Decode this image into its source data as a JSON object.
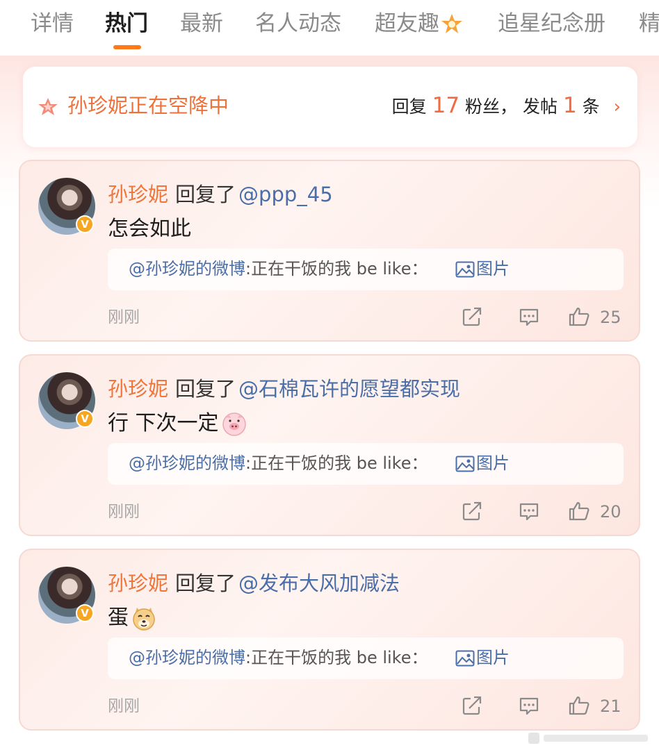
{
  "tabs": [
    {
      "label": "详情"
    },
    {
      "label": "热门"
    },
    {
      "label": "最新"
    },
    {
      "label": "名人动态"
    },
    {
      "label": "超友趣"
    },
    {
      "label": "追星纪念册"
    },
    {
      "label": "精"
    }
  ],
  "airdrop": {
    "title": "孙珍妮正在空降中",
    "reply_prefix": "回复",
    "reply_count": "17",
    "reply_suffix": "粉丝，",
    "post_prefix": "发帖",
    "post_count": "1",
    "post_suffix": "条",
    "chevron": "›"
  },
  "comments": [
    {
      "author": "孙珍妮",
      "reply_label": "回复了",
      "reply_to": "@ppp_45",
      "text": "怎会如此",
      "emoji": "",
      "quote_at": "@孙珍妮的微博",
      "quote_text": ":正在干饭的我 be like：",
      "quote_pic": "图片",
      "time": "刚刚",
      "likes": "25"
    },
    {
      "author": "孙珍妮",
      "reply_label": "回复了",
      "reply_to": "@石棉瓦许的愿望都实现",
      "text": "行 下次一定",
      "emoji": "pig-face",
      "quote_at": "@孙珍妮的微博",
      "quote_text": ":正在干饭的我 be like：",
      "quote_pic": "图片",
      "time": "刚刚",
      "likes": "20"
    },
    {
      "author": "孙珍妮",
      "reply_label": "回复了",
      "reply_to": "@发布大风加减法",
      "text": "蛋",
      "emoji": "doge-face",
      "quote_at": "@孙珍妮的微博",
      "quote_text": ":正在干饭的我 be like：",
      "quote_pic": "图片",
      "time": "刚刚",
      "likes": "21"
    }
  ],
  "colors": {
    "accent": "#f26a3d",
    "name": "#f0753a",
    "link": "#4a6ea8",
    "tab_underline": "#ff7a1a"
  }
}
